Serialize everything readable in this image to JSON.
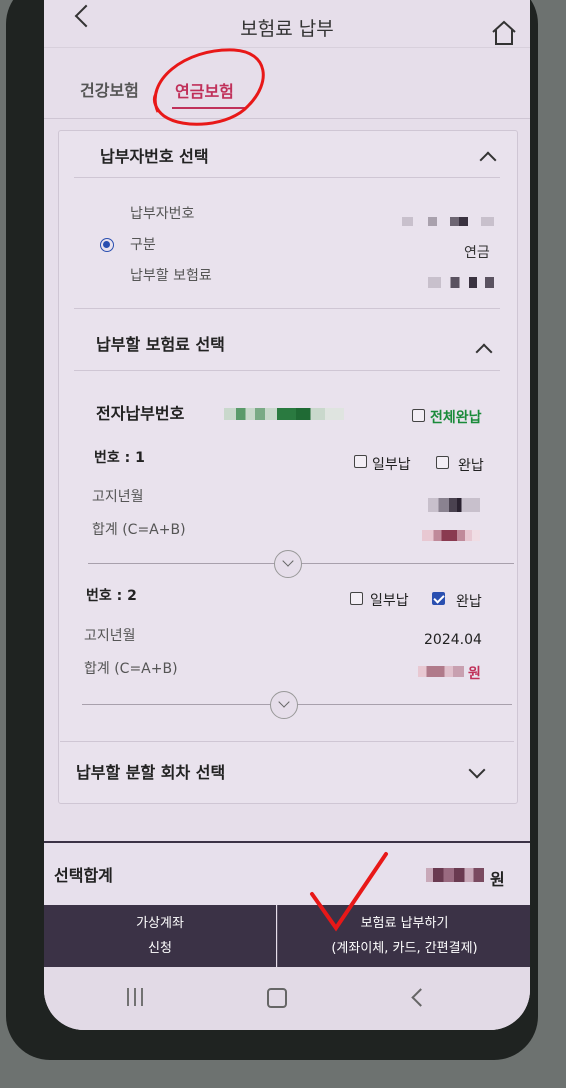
{
  "header": {
    "title": "보험료 납부"
  },
  "tabs": [
    {
      "label": "건강보험"
    },
    {
      "label": "연금보험",
      "active": true
    }
  ],
  "section_payer": {
    "title": "납부자번호 선택",
    "labels": {
      "payer_no": "납부자번호",
      "type": "구분",
      "amount": "납부할 보험료"
    },
    "type_value": "연금"
  },
  "section_premium": {
    "title": "납부할 보험료 선택",
    "epay_label": "전자납부번호",
    "full_pay_all": "전체완납",
    "items": [
      {
        "number": "번호 : 1",
        "partial": "일부납",
        "full": "완납",
        "full_checked": false,
        "month_label": "고지년월",
        "total_label": "합계 (C=A+B)",
        "month": "",
        "total_unit": ""
      },
      {
        "number": "번호 : 2",
        "partial": "일부납",
        "full": "완납",
        "full_checked": true,
        "month_label": "고지년월",
        "total_label": "합계 (C=A+B)",
        "month": "2024.04",
        "total_unit": "원"
      }
    ]
  },
  "section_installment": {
    "title": "납부할 분할 회차 선택"
  },
  "summary": {
    "label": "선택합계",
    "unit": "원"
  },
  "buttons": {
    "virtual": {
      "line1": "가상계좌",
      "line2": "신청"
    },
    "pay": {
      "line1": "보험료 납부하기",
      "line2": "(계좌이체, 카드, 간편결제)"
    }
  },
  "colors": {
    "accent": "#c0305a",
    "green": "#1a8a3a",
    "dark_bar": "#3b3246",
    "annotation": "#e81818"
  }
}
